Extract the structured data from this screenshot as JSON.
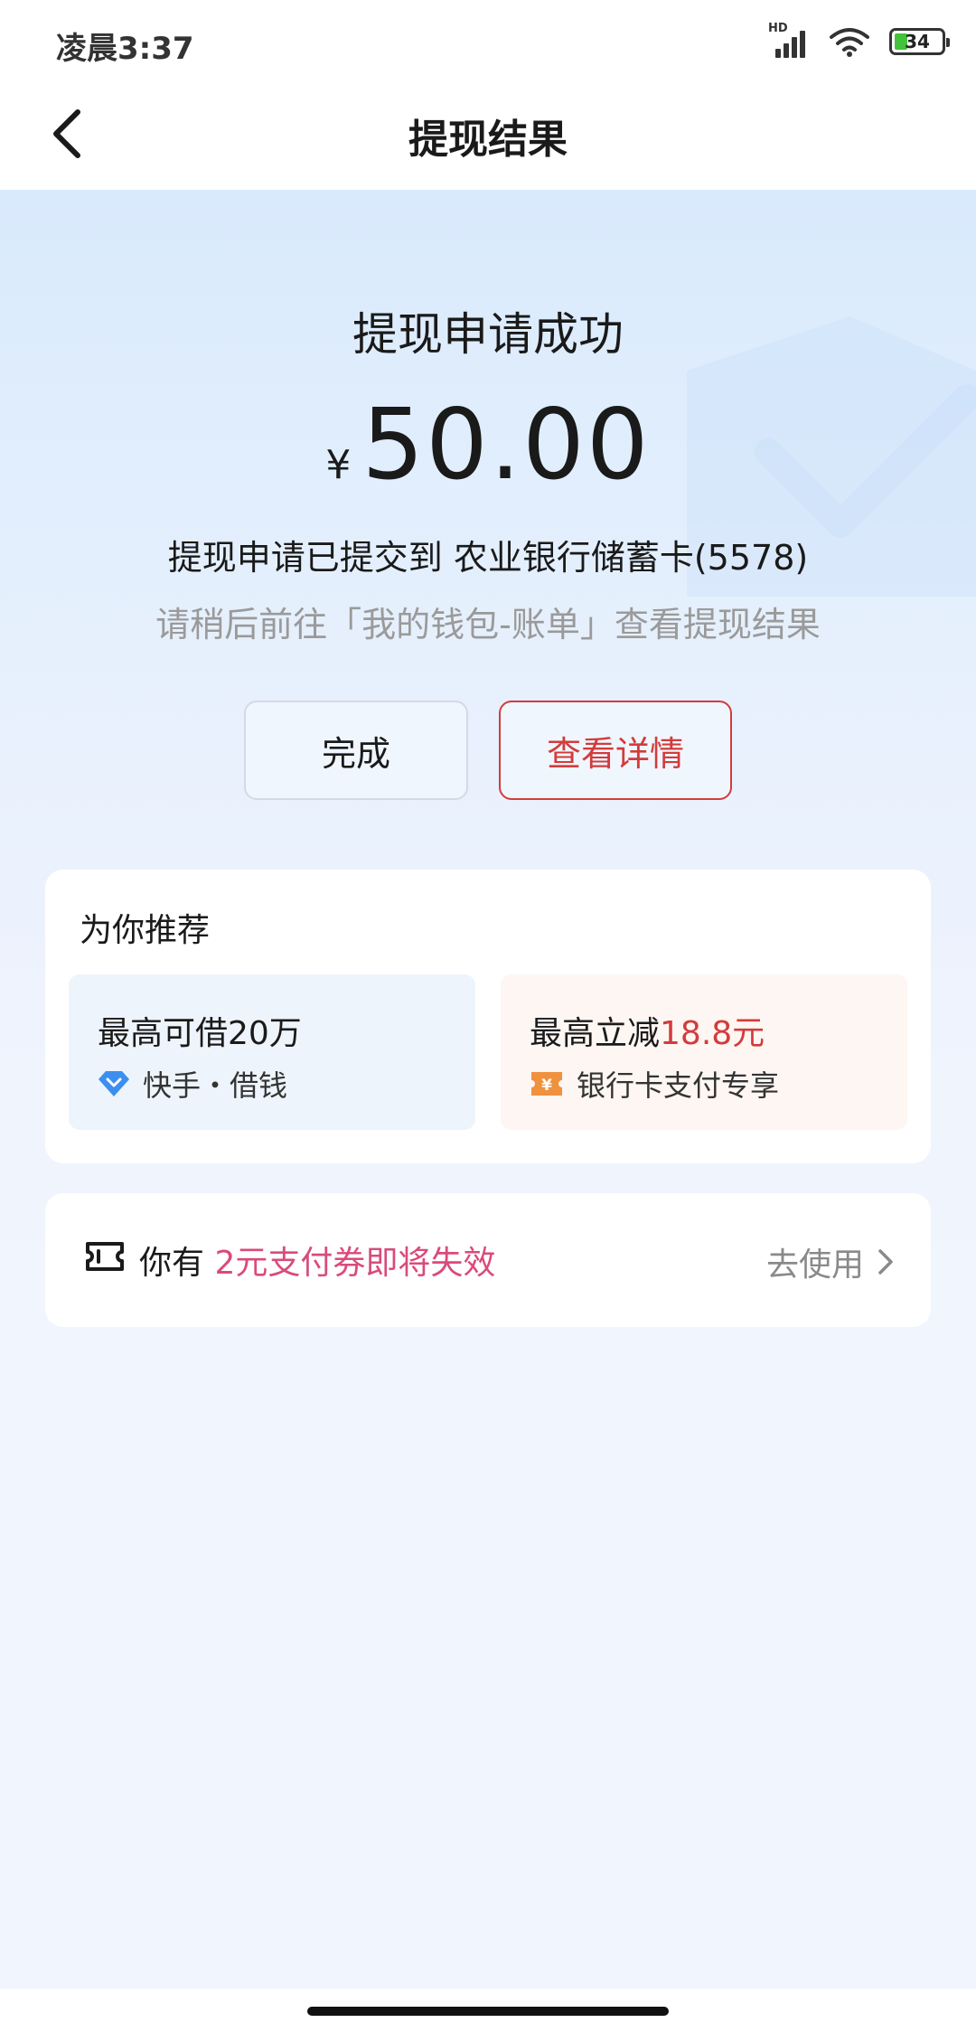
{
  "status_bar": {
    "time": "凌晨3:37",
    "network_label": "HD",
    "battery_level": "34"
  },
  "nav": {
    "title": "提现结果"
  },
  "result": {
    "title": "提现申请成功",
    "currency_symbol": "¥",
    "amount": "50.00",
    "submitted_text": "提现申请已提交到 农业银行储蓄卡(5578)",
    "hint_text": "请稍后前往「我的钱包-账单」查看提现结果"
  },
  "actions": {
    "done_label": "完成",
    "detail_label": "查看详情"
  },
  "recommend": {
    "title": "为你推荐",
    "items": [
      {
        "main_prefix": "最高可借20万",
        "main_highlight": "",
        "sub_text": "快手・借钱",
        "icon": "diamond-icon"
      },
      {
        "main_prefix": "最高立减",
        "main_highlight": "18.8元",
        "sub_text": "银行卡支付专享",
        "icon": "yuan-ticket-icon"
      }
    ]
  },
  "coupon": {
    "prefix": "你有",
    "highlight": "2元支付券即将失效",
    "action_label": "去使用"
  },
  "colors": {
    "accent_red": "#d23c3c",
    "coupon_pink": "#d94b7a",
    "diamond_blue": "#3d8fef",
    "ticket_orange": "#f0913e"
  }
}
